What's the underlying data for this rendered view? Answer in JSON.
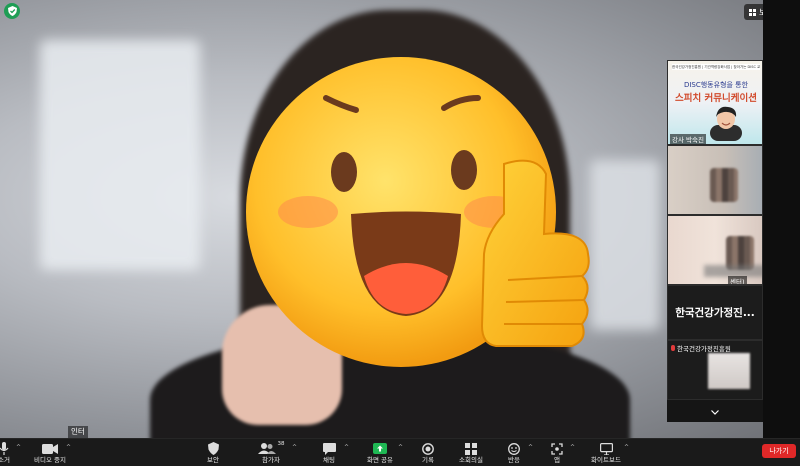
{
  "view_button": {
    "label": "보기"
  },
  "main": {
    "name_tag": "인터"
  },
  "right_panel": {
    "speaker": {
      "banner_top": "한국건강가정진흥원 | 기관역량강화사업 | 찾아가는 DISC 교육",
      "line1": "DISC행동유형을 통한",
      "line2": "스피치 커뮤니케이션",
      "label": "강사 박숙진"
    },
    "participant3": {
      "label": "센터)"
    },
    "name_only": {
      "name": "한국건강가정진..."
    },
    "org": {
      "label": "한국건강가정진흥원"
    }
  },
  "toolbar": {
    "items": [
      {
        "label": "소거"
      },
      {
        "label": "비디오 중지"
      },
      {
        "label": "보안"
      },
      {
        "label": "참가자",
        "count": "38"
      },
      {
        "label": "채팅"
      },
      {
        "label": "화면 공유"
      },
      {
        "label": "기록"
      },
      {
        "label": "소회의실"
      },
      {
        "label": "반응"
      },
      {
        "label": "앱"
      },
      {
        "label": "화이트보드"
      }
    ],
    "leave_label": "나가기"
  },
  "colors": {
    "share_green": "#1fb854",
    "leave_red": "#e02828",
    "security_green": "#1f9d55"
  }
}
